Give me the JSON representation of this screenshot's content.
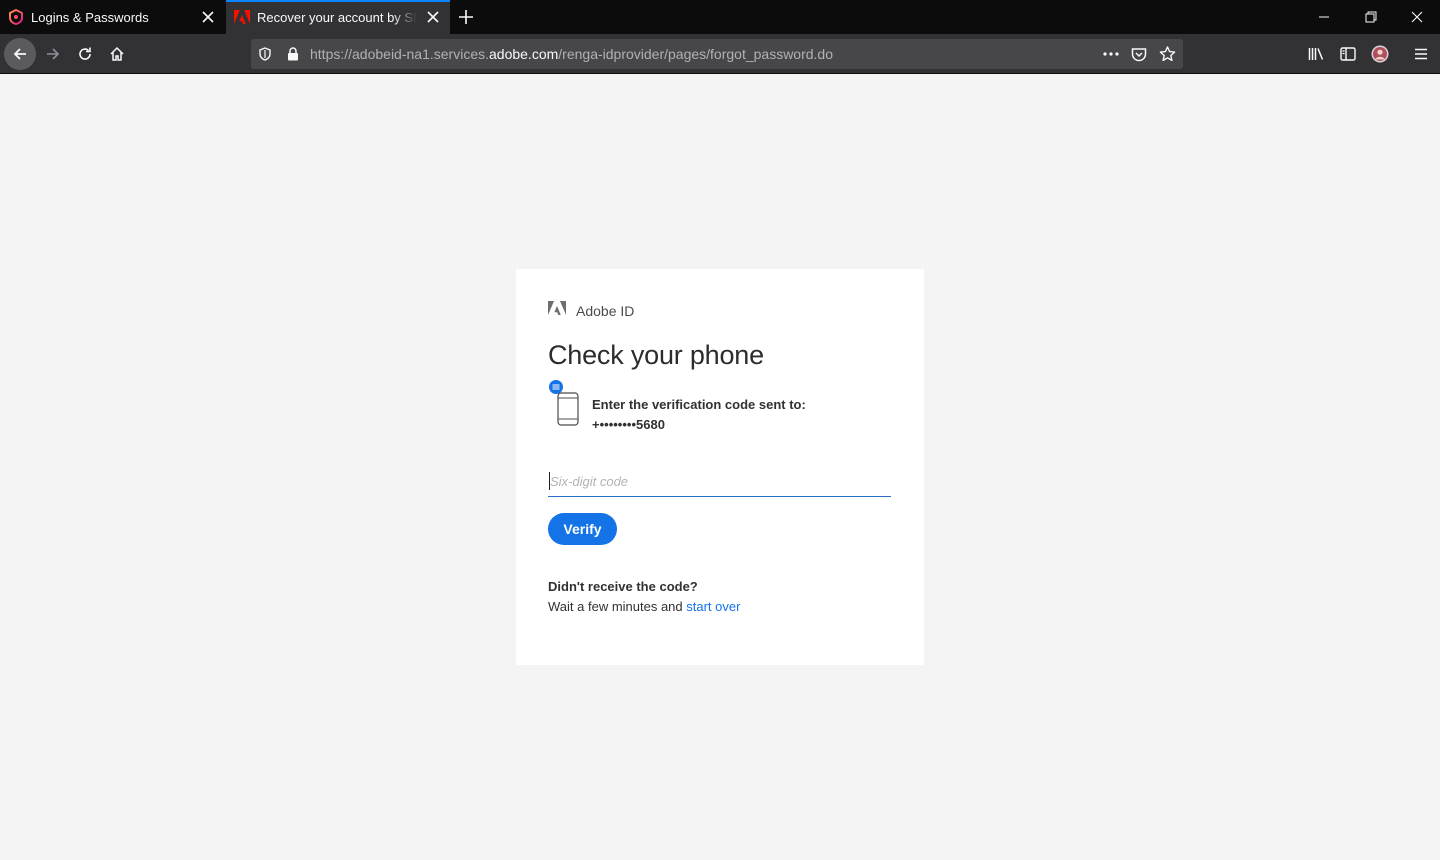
{
  "browser": {
    "tabs": [
      {
        "title": "Logins & Passwords",
        "active": false,
        "favicon": "lockwise-icon"
      },
      {
        "title": "Recover your account by SMS",
        "active": true,
        "favicon": "adobe-icon"
      }
    ],
    "url": {
      "prefix": "https://adobeid-na1.services.",
      "domain": "adobe.com",
      "path": "/renga-idprovider/pages/forgot_password.do"
    },
    "accent_color": "#0a84ff"
  },
  "page": {
    "brand_label": "Adobe ID",
    "heading": "Check your phone",
    "sent_label": "Enter the verification code sent to:",
    "sent_number": "+••••••••5680",
    "code_input": {
      "value": "",
      "placeholder": "Six-digit code"
    },
    "verify_label": "Verify",
    "help_title": "Didn't receive the code?",
    "help_text": "Wait a few minutes and ",
    "help_link": "start over",
    "button_color": "#1473e6"
  }
}
